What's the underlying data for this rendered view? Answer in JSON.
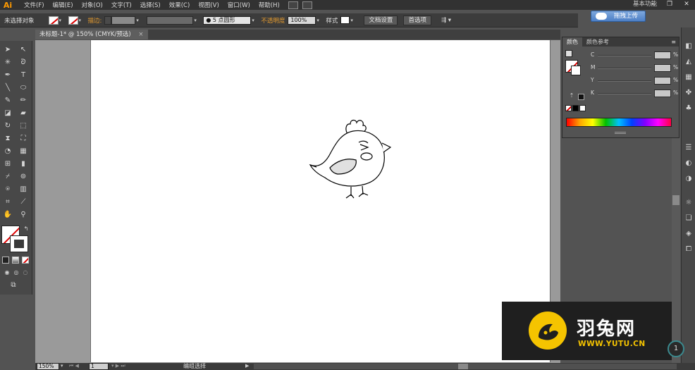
{
  "app": {
    "logo": "Ai"
  },
  "menu": [
    "文件(F)",
    "编辑(E)",
    "对象(O)",
    "文字(T)",
    "选择(S)",
    "效果(C)",
    "视图(V)",
    "窗口(W)",
    "帮助(H)"
  ],
  "workspace": "基本功能",
  "upload_button": "拖拽上传",
  "control_bar": {
    "selection": "未选择对象",
    "stroke_label": "描边:",
    "brush_label": "5 点圆形",
    "opacity_label": "不透明度",
    "opacity_value": "100%",
    "style_label": "样式",
    "doc_setup": "文档设置",
    "preferences": "首选项"
  },
  "document_tab": {
    "title": "未标题-1* @ 150% (CMYK/预选)",
    "close": "×"
  },
  "color_panel": {
    "tabs": [
      "颜色",
      "颜色参考"
    ],
    "channels": [
      {
        "label": "C",
        "unit": "%"
      },
      {
        "label": "M",
        "unit": "%"
      },
      {
        "label": "Y",
        "unit": "%"
      },
      {
        "label": "K",
        "unit": "%"
      }
    ]
  },
  "status_bar": {
    "zoom": "150%",
    "page": "1",
    "tool": "编组选择"
  },
  "watermark": {
    "title": "羽兔网",
    "url": "WWW.YUTU.CN"
  },
  "circle_button": "1",
  "colors": {
    "chrome": "#535353",
    "menubar": "#323232",
    "artboard": "#ffffff",
    "watermark_accent": "#f5c400",
    "upload_blue": "#4c7fc6",
    "stroke_label_orange": "#e39a2f"
  }
}
